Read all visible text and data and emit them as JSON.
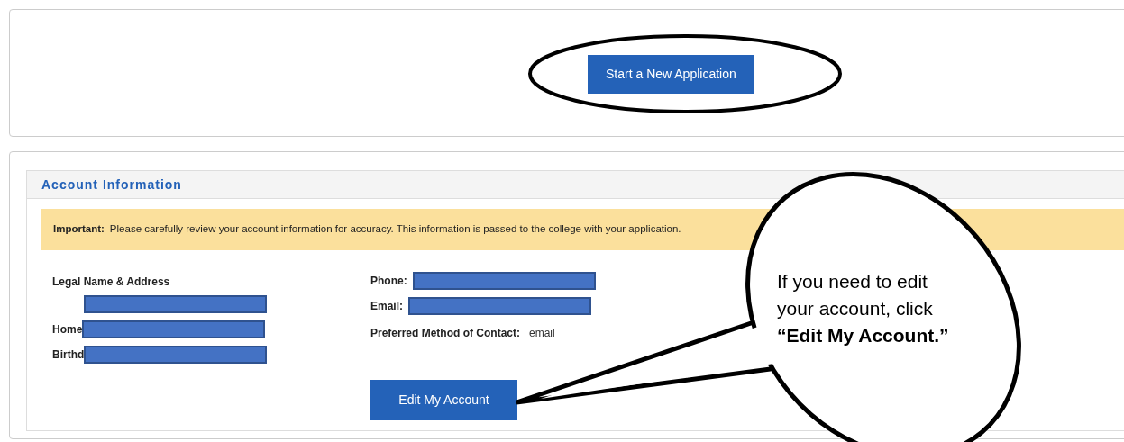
{
  "start_button": {
    "label": "Start a New Application"
  },
  "account": {
    "title": "Account Information",
    "notice": {
      "label": "Important:",
      "text": "Please carefully review your account information for accuracy. This information is passed to the college with your application."
    },
    "left": {
      "heading": "Legal Name & Address",
      "rows": [
        {
          "label": ""
        },
        {
          "label": "Home"
        },
        {
          "label": "Birthd"
        }
      ]
    },
    "right": {
      "fields": [
        {
          "label": "Phone:"
        },
        {
          "label": "Email:"
        }
      ],
      "preferred": {
        "label": "Preferred Method of Contact:",
        "value": "email"
      }
    },
    "edit_button": {
      "label": "Edit My Account"
    }
  },
  "callout": {
    "text": "If you need to edit your account, click **“Edit My Account.”**"
  }
}
